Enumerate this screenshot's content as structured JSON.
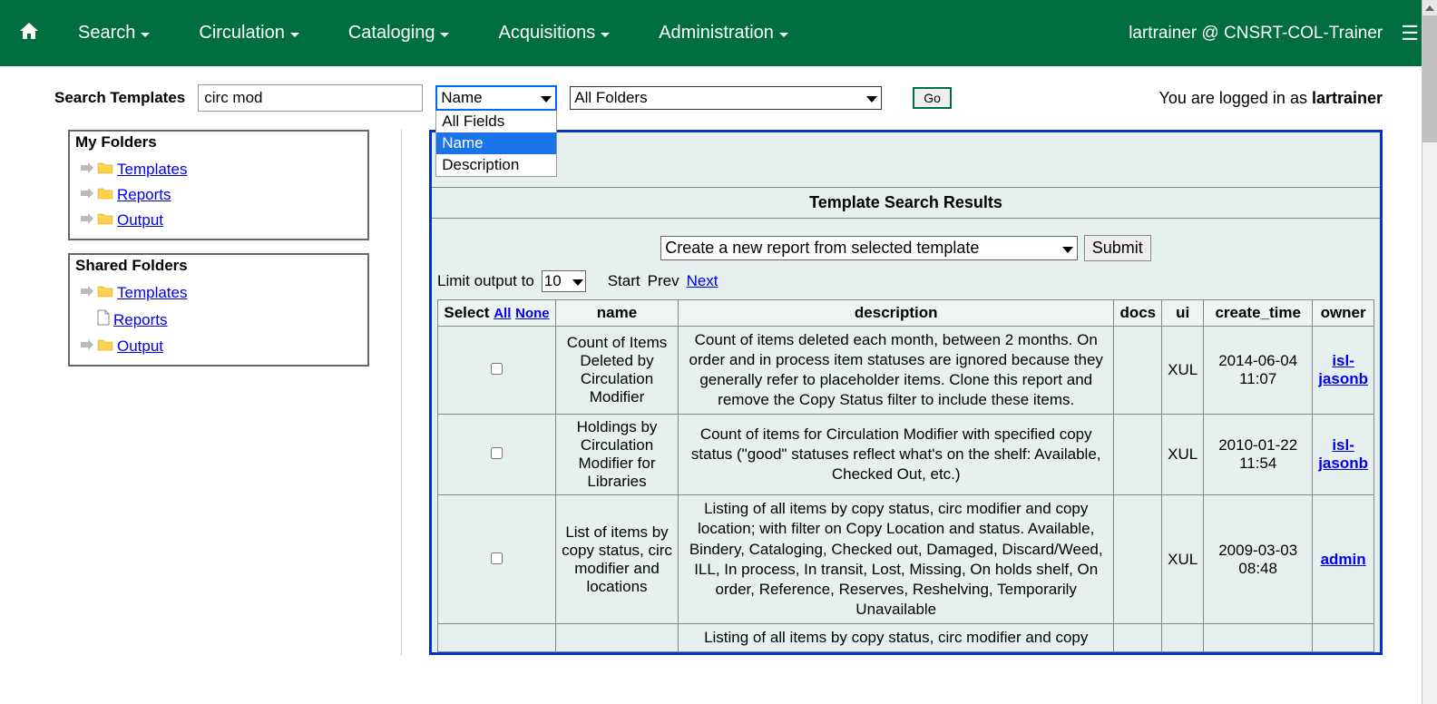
{
  "topbar": {
    "nav": [
      "Search",
      "Circulation",
      "Cataloging",
      "Acquisitions",
      "Administration"
    ],
    "user_display": "lartrainer @ CNSRT-COL-Trainer"
  },
  "search_bar": {
    "label": "Search Templates",
    "input_value": "circ mod",
    "field_select": {
      "value": "Name",
      "options": [
        "All Fields",
        "Name",
        "Description"
      ],
      "selected_index": 1
    },
    "folder_select_value": "All Folders",
    "go_label": "Go",
    "logged_in_prefix": "You are logged in as ",
    "logged_in_user": "lartrainer"
  },
  "sidebar": {
    "my_folders_title": "My Folders",
    "shared_folders_title": "Shared Folders",
    "my_items": [
      {
        "label": "Templates",
        "icon": "folder"
      },
      {
        "label": "Reports",
        "icon": "folder"
      },
      {
        "label": "Output",
        "icon": "folder"
      }
    ],
    "shared_items": [
      {
        "label": "Templates",
        "icon": "folder"
      },
      {
        "label": "Reports",
        "icon": "doc"
      },
      {
        "label": "Output",
        "icon": "folder"
      }
    ]
  },
  "results": {
    "header": "Template Search Results",
    "action_select_value": "Create a new report from selected template",
    "submit_label": "Submit",
    "limit_label": "Limit output to",
    "limit_value": "10",
    "pager": {
      "start": "Start",
      "prev": "Prev",
      "next": "Next"
    },
    "columns": {
      "select": "Select",
      "select_all": "All",
      "select_none": "None",
      "name": "name",
      "description": "description",
      "docs": "docs",
      "ui": "ui",
      "create_time": "create_time",
      "owner": "owner"
    },
    "rows": [
      {
        "name": "Count of Items Deleted by Circulation Modifier",
        "description": "Count of items deleted each month, between 2 months. On order and in process item statuses are ignored because they generally refer to placeholder items. Clone this report and remove the Copy Status filter to include these items.",
        "docs": "",
        "ui": "XUL",
        "create_time": "2014-06-04 11:07",
        "owner": "isl-jasonb"
      },
      {
        "name": "Holdings by Circulation Modifier for Libraries",
        "description": "Count of items for Circulation Modifier with specified copy status (\"good\" statuses reflect what's on the shelf: Available, Checked Out, etc.)",
        "docs": "",
        "ui": "XUL",
        "create_time": "2010-01-22 11:54",
        "owner": "isl-jasonb"
      },
      {
        "name": "List of items by copy status, circ modifier and locations",
        "description": "Listing of all items by copy status, circ modifier and copy location; with filter on Copy Location and status. Available, Bindery, Cataloging, Checked out, Damaged, Discard/Weed, ILL, In process, In transit, Lost, Missing, On holds shelf, On order, Reference, Reserves, Reshelving, Temporarily Unavailable",
        "docs": "",
        "ui": "XUL",
        "create_time": "2009-03-03 08:48",
        "owner": "admin"
      }
    ],
    "partial_row_desc": "Listing of all items by copy status, circ modifier and copy"
  }
}
